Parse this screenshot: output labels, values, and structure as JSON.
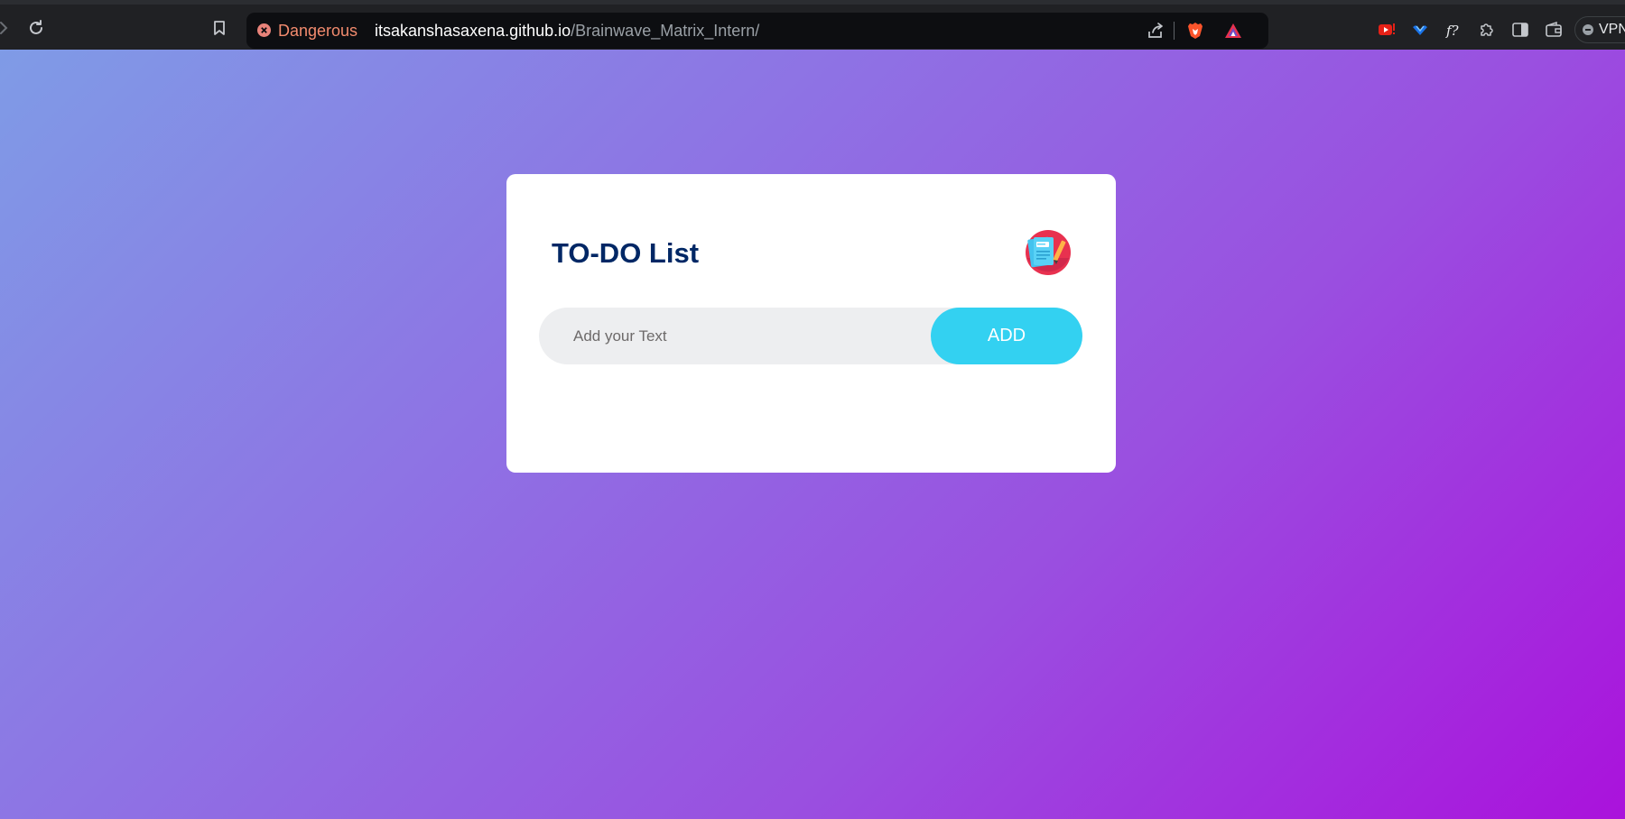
{
  "browser": {
    "security_label": "Dangerous",
    "url_host": "itsakanshasaxena.github.io",
    "url_path": "/Brainwave_Matrix_Intern/",
    "vpn_label": "VPN",
    "toolbar_icons": [
      "forward-icon",
      "reload-icon",
      "bookmark-icon"
    ],
    "omnibox_icons": [
      "share-icon",
      "brave-shields-icon",
      "brave-rewards-icon"
    ],
    "extension_icons": [
      "youtube-ext-icon",
      "vee-ext-icon",
      "font-ext-icon",
      "extensions-puzzle-icon",
      "sidebar-icon",
      "wallet-icon"
    ]
  },
  "app": {
    "title": "TO-DO List",
    "input_placeholder": "Add your Text",
    "input_value": "",
    "add_button_label": "ADD",
    "tasks": []
  },
  "colors": {
    "title": "#002765",
    "add_button": "#33d1f1",
    "danger": "#f28b6e",
    "gradient_start": "#7f9be6",
    "gradient_end": "#aa12dc"
  }
}
